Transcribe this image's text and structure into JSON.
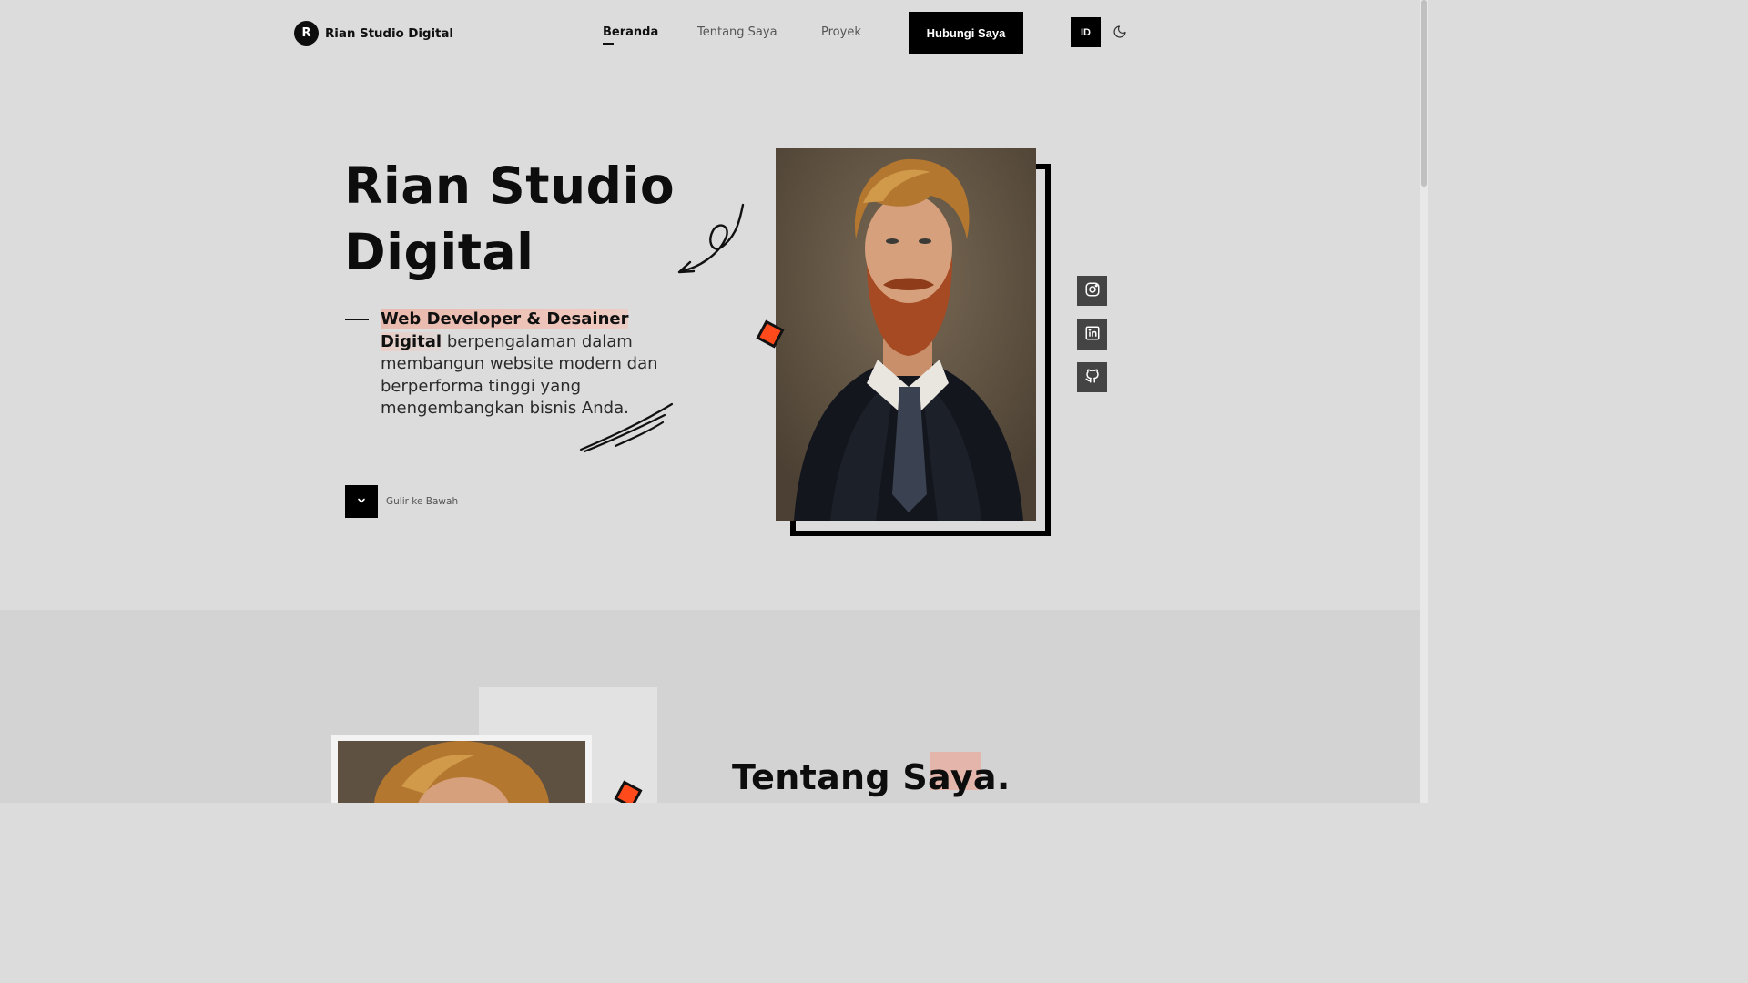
{
  "brand": {
    "initial": "R",
    "name": "Rian Studio Digital"
  },
  "nav": {
    "items": [
      {
        "label": "Beranda",
        "active": true
      },
      {
        "label": "Tentang Saya",
        "active": false
      },
      {
        "label": "Proyek",
        "active": false
      }
    ],
    "cta_label": "Hubungi Saya",
    "lang_label": "ID",
    "theme_icon": "moon-icon"
  },
  "hero": {
    "title_line1": "Rian Studio",
    "title_line2": "Digital",
    "highlight": "Web Developer & Desainer Digital",
    "description": "berpengalaman dalam membangun website modern dan berperforma tinggi yang mengembangkan bisnis Anda.",
    "scroll_label": "Gulir ke Bawah",
    "scroll_icon": "chevron-down-icon"
  },
  "social": [
    {
      "icon": "instagram-icon"
    },
    {
      "icon": "linkedin-icon"
    },
    {
      "icon": "github-icon"
    }
  ],
  "about": {
    "title": "Tentang Saya."
  },
  "colors": {
    "background": "#dcdcdc",
    "accent_orange": "#ff4a1c",
    "highlight_pink": "#e9b9ad",
    "black": "#000000",
    "social_bg": "#444444"
  }
}
